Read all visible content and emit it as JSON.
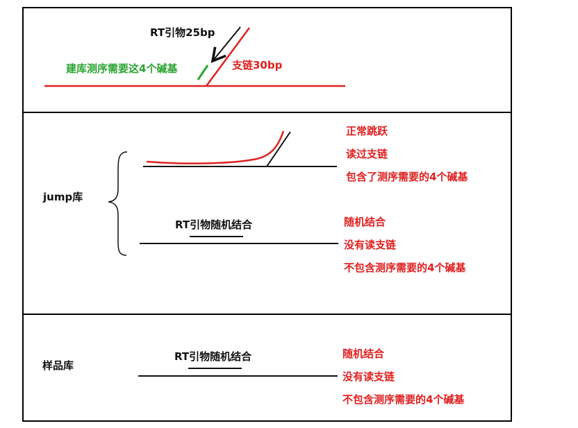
{
  "colors": {
    "frame": "#000000",
    "red": "#e02020",
    "green": "#2aa532",
    "black": "#111111"
  },
  "top_panel": {
    "primer_label": "RT引物25bp",
    "build_label": "建库测序需要这4个碱基",
    "branch_label": "支链30bp"
  },
  "jump_panel": {
    "library_label": "jump库",
    "case1": {
      "line1": "正常跳跃",
      "line2": "读过支链",
      "line3": "包含了测序需要的4个碱基"
    },
    "primer_label": "RT引物随机结合",
    "case2": {
      "line1": "随机结合",
      "line2": "没有读支链",
      "line3": "不包含测序需要的4个碱基"
    }
  },
  "sample_panel": {
    "library_label": "样品库",
    "primer_label": "RT引物随机结合",
    "line1": "随机结合",
    "line2": "没有读支链",
    "line3": "不包含测序需要的4个碱基"
  }
}
